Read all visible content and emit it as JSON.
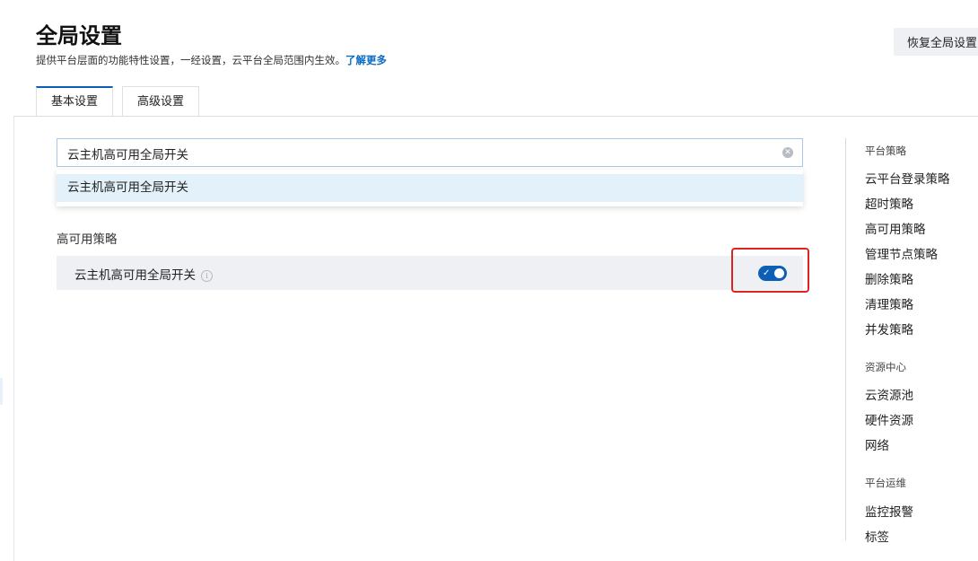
{
  "header": {
    "title": "全局设置",
    "description": "提供平台层面的功能特性设置，一经设置，云平台全局范围内生效。",
    "learn_more": "了解更多",
    "restore_button": "恢复全局设置"
  },
  "tabs": [
    {
      "label": "基本设置",
      "active": true
    },
    {
      "label": "高级设置",
      "active": false
    }
  ],
  "search": {
    "value": "云主机高可用全局开关",
    "suggestion": "云主机高可用全局开关"
  },
  "section": {
    "title": "高可用策略",
    "setting": {
      "label": "云主机高可用全局开关",
      "info_icon": "info-icon",
      "toggle_on": true,
      "toggle_color": "#0b5fb4"
    }
  },
  "colors": {
    "accent": "#0b5fb4",
    "link": "#0b6bc2",
    "highlight": "#e0231f",
    "dropdown_highlight": "#e2f1fa"
  },
  "nav": {
    "groups": [
      {
        "title": "平台策略",
        "items": [
          "云平台登录策略",
          "超时策略",
          "高可用策略",
          "管理节点策略",
          "删除策略",
          "清理策略",
          "并发策略"
        ]
      },
      {
        "title": "资源中心",
        "items": [
          "云资源池",
          "硬件资源",
          "网络"
        ]
      },
      {
        "title": "平台运维",
        "items": [
          "监控报警",
          "标签"
        ]
      }
    ]
  }
}
